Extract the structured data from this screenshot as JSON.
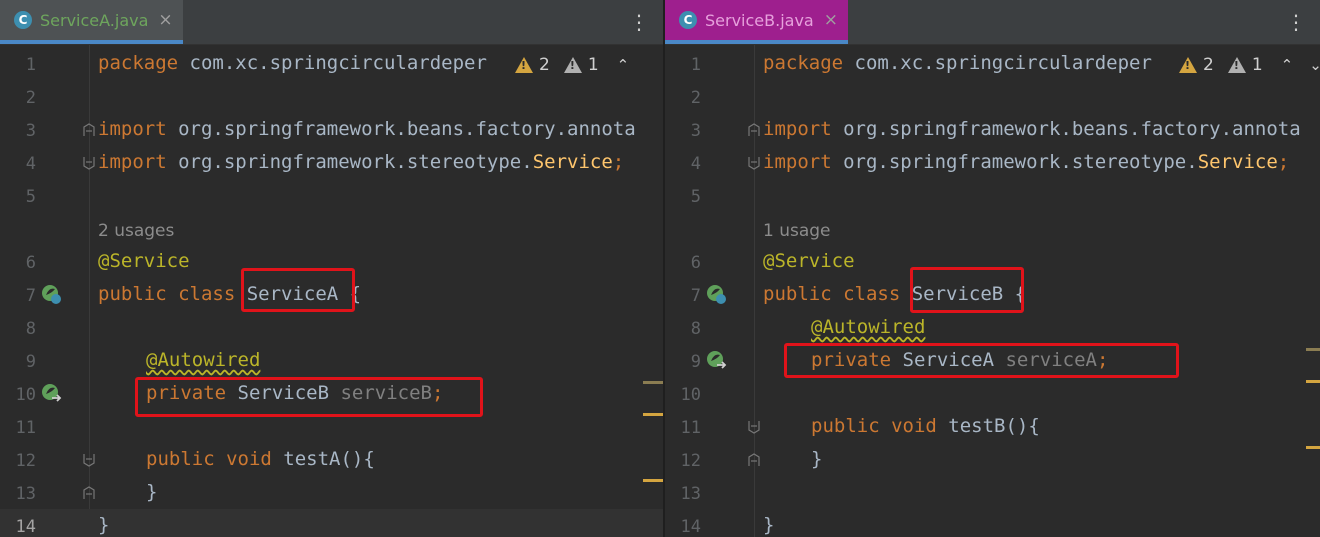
{
  "panes": [
    {
      "tab": {
        "icon_letter": "C",
        "name": "ServiceA.java",
        "close": "×"
      },
      "menu": "⋮",
      "inspections": {
        "warnings": "2",
        "weak_warnings": "1"
      },
      "line_numbers": [
        "1",
        "2",
        "3",
        "4",
        "5",
        "6",
        "7",
        "8",
        "9",
        "10",
        "11",
        "12",
        "13",
        "14"
      ],
      "usage_hint": "2 usages",
      "code": {
        "l1_kw": "package",
        "l1_rest": " com.xc.springcirculardeper",
        "l3_kw": "import",
        "l3_rest": " org.springframework.beans.factory.annota",
        "l4_kw": "import",
        "l4_rest": " org.springframework.stereotype.",
        "l4_cls": "Service",
        "l4_end": ";",
        "l6_ann": "@Service",
        "l7_kw": "public class ",
        "l7_cls": "ServiceA",
        "l7_end": " {",
        "l9_ann": "@Autowired",
        "l10_kw": "private ",
        "l10_type": "ServiceB",
        "l10_field": " serviceB",
        "l10_end": ";",
        "l12_kw": "public void ",
        "l12_name": "testA",
        "l12_end": "(){",
        "l13": "}",
        "l14": "}"
      }
    },
    {
      "tab": {
        "icon_letter": "C",
        "name": "ServiceB.java",
        "close": "×"
      },
      "menu": "⋮",
      "inspections": {
        "warnings": "2",
        "weak_warnings": "1"
      },
      "line_numbers": [
        "1",
        "2",
        "3",
        "4",
        "5",
        "6",
        "7",
        "8",
        "9",
        "10",
        "11",
        "12",
        "13",
        "14"
      ],
      "usage_hint": "1 usage",
      "code": {
        "l1_kw": "package",
        "l1_rest": " com.xc.springcirculardeper",
        "l3_kw": "import",
        "l3_rest": " org.springframework.beans.factory.annota",
        "l4_kw": "import",
        "l4_rest": " org.springframework.stereotype.",
        "l4_cls": "Service",
        "l4_end": ";",
        "l6_ann": "@Service",
        "l7_kw": "public class ",
        "l7_cls": "ServiceB",
        "l7_end": " {",
        "l8_ann": "@Autowired",
        "l9_kw": "private ",
        "l9_type": "ServiceA",
        "l9_field": " serviceA",
        "l9_end": ";",
        "l11_kw": "public void ",
        "l11_name": "testB",
        "l11_end": "(){",
        "l12": "}",
        "l14": "}"
      }
    }
  ],
  "colors": {
    "highlight": "#e0131a",
    "keyword": "#cc7832",
    "annotation": "#bbb529",
    "field": "#9876aa",
    "paneB_tab": "#9e1f8e"
  }
}
